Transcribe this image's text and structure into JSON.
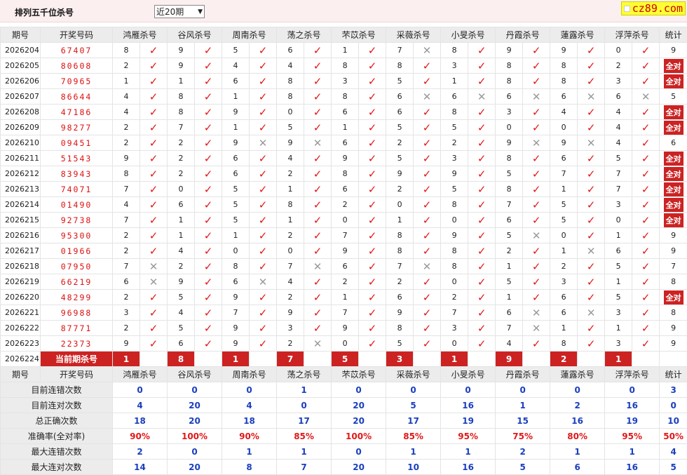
{
  "header": {
    "title": "排列五千位杀号",
    "period_select": "近20期",
    "logo": "cz89.com"
  },
  "columns": {
    "issue": "期号",
    "winning": "开奖号码",
    "experts": [
      "鸿雁杀号",
      "谷风杀号",
      "周南杀号",
      "荡之杀号",
      "芣苡杀号",
      "采薇杀号",
      "小旻杀号",
      "丹霞杀号",
      "蓮露杀号",
      "浮萍杀号"
    ],
    "stat": "统计"
  },
  "rows": [
    {
      "issue": "2026204",
      "nums": "67407",
      "kills": [
        "8",
        "9",
        "5",
        "6",
        "1",
        "7",
        "8",
        "9",
        "9",
        "0"
      ],
      "marks": [
        1,
        1,
        1,
        1,
        1,
        0,
        1,
        1,
        1,
        1
      ],
      "stat": "9"
    },
    {
      "issue": "2026205",
      "nums": "80608",
      "kills": [
        "2",
        "9",
        "4",
        "4",
        "8",
        "8",
        "3",
        "8",
        "8",
        "2"
      ],
      "marks": [
        1,
        1,
        1,
        1,
        1,
        1,
        1,
        1,
        1,
        1
      ],
      "stat": "全对"
    },
    {
      "issue": "2026206",
      "nums": "70965",
      "kills": [
        "1",
        "1",
        "6",
        "8",
        "3",
        "5",
        "1",
        "8",
        "8",
        "3"
      ],
      "marks": [
        1,
        1,
        1,
        1,
        1,
        1,
        1,
        1,
        1,
        1
      ],
      "stat": "全对"
    },
    {
      "issue": "2026207",
      "nums": "86644",
      "kills": [
        "4",
        "8",
        "1",
        "8",
        "8",
        "6",
        "6",
        "6",
        "6",
        "6"
      ],
      "marks": [
        1,
        1,
        1,
        1,
        1,
        0,
        0,
        0,
        0,
        0
      ],
      "stat": "5"
    },
    {
      "issue": "2026208",
      "nums": "47186",
      "kills": [
        "4",
        "8",
        "9",
        "0",
        "6",
        "6",
        "8",
        "3",
        "4",
        "4"
      ],
      "marks": [
        1,
        1,
        1,
        1,
        1,
        1,
        1,
        1,
        1,
        1
      ],
      "stat": "全对"
    },
    {
      "issue": "2026209",
      "nums": "98277",
      "kills": [
        "2",
        "7",
        "1",
        "5",
        "1",
        "5",
        "5",
        "0",
        "0",
        "4"
      ],
      "marks": [
        1,
        1,
        1,
        1,
        1,
        1,
        1,
        1,
        1,
        1
      ],
      "stat": "全对"
    },
    {
      "issue": "2026210",
      "nums": "09451",
      "kills": [
        "2",
        "2",
        "9",
        "9",
        "6",
        "2",
        "2",
        "9",
        "9",
        "4"
      ],
      "marks": [
        1,
        1,
        0,
        0,
        1,
        1,
        1,
        0,
        0,
        1
      ],
      "stat": "6"
    },
    {
      "issue": "2026211",
      "nums": "51543",
      "kills": [
        "9",
        "2",
        "6",
        "4",
        "9",
        "5",
        "3",
        "8",
        "6",
        "5"
      ],
      "marks": [
        1,
        1,
        1,
        1,
        1,
        1,
        1,
        1,
        1,
        1
      ],
      "stat": "全对"
    },
    {
      "issue": "2026212",
      "nums": "83943",
      "kills": [
        "8",
        "2",
        "6",
        "2",
        "8",
        "9",
        "9",
        "5",
        "7",
        "7"
      ],
      "marks": [
        1,
        1,
        1,
        1,
        1,
        1,
        1,
        1,
        1,
        1
      ],
      "stat": "全对"
    },
    {
      "issue": "2026213",
      "nums": "74071",
      "kills": [
        "7",
        "0",
        "5",
        "1",
        "6",
        "2",
        "5",
        "8",
        "1",
        "7"
      ],
      "marks": [
        1,
        1,
        1,
        1,
        1,
        1,
        1,
        1,
        1,
        1
      ],
      "stat": "全对"
    },
    {
      "issue": "2026214",
      "nums": "01490",
      "kills": [
        "4",
        "6",
        "5",
        "8",
        "2",
        "0",
        "8",
        "7",
        "5",
        "3"
      ],
      "marks": [
        1,
        1,
        1,
        1,
        1,
        1,
        1,
        1,
        1,
        1
      ],
      "stat": "全对"
    },
    {
      "issue": "2026215",
      "nums": "92738",
      "kills": [
        "7",
        "1",
        "5",
        "1",
        "0",
        "1",
        "0",
        "6",
        "5",
        "0"
      ],
      "marks": [
        1,
        1,
        1,
        1,
        1,
        1,
        1,
        1,
        1,
        1
      ],
      "stat": "全对"
    },
    {
      "issue": "2026216",
      "nums": "95300",
      "kills": [
        "2",
        "1",
        "1",
        "2",
        "7",
        "8",
        "9",
        "5",
        "0",
        "1"
      ],
      "marks": [
        1,
        1,
        1,
        1,
        1,
        1,
        1,
        0,
        1,
        1
      ],
      "stat": "9"
    },
    {
      "issue": "2026217",
      "nums": "01966",
      "kills": [
        "2",
        "4",
        "0",
        "0",
        "9",
        "8",
        "8",
        "2",
        "1",
        "6"
      ],
      "marks": [
        1,
        1,
        1,
        1,
        1,
        1,
        1,
        1,
        0,
        1
      ],
      "stat": "9"
    },
    {
      "issue": "2026218",
      "nums": "07950",
      "kills": [
        "7",
        "2",
        "8",
        "7",
        "6",
        "7",
        "8",
        "1",
        "2",
        "5"
      ],
      "marks": [
        0,
        1,
        1,
        0,
        1,
        0,
        1,
        1,
        1,
        1
      ],
      "stat": "7"
    },
    {
      "issue": "2026219",
      "nums": "66219",
      "kills": [
        "6",
        "9",
        "6",
        "4",
        "2",
        "2",
        "0",
        "5",
        "3",
        "1"
      ],
      "marks": [
        0,
        1,
        0,
        1,
        1,
        1,
        1,
        1,
        1,
        1
      ],
      "stat": "8"
    },
    {
      "issue": "2026220",
      "nums": "48299",
      "kills": [
        "2",
        "5",
        "9",
        "2",
        "1",
        "6",
        "2",
        "1",
        "6",
        "5"
      ],
      "marks": [
        1,
        1,
        1,
        1,
        1,
        1,
        1,
        1,
        1,
        1
      ],
      "stat": "全对"
    },
    {
      "issue": "2026221",
      "nums": "96988",
      "kills": [
        "3",
        "4",
        "7",
        "9",
        "7",
        "9",
        "7",
        "6",
        "6",
        "3"
      ],
      "marks": [
        1,
        1,
        1,
        1,
        1,
        1,
        1,
        0,
        0,
        1
      ],
      "stat": "8"
    },
    {
      "issue": "2026222",
      "nums": "87771",
      "kills": [
        "2",
        "5",
        "9",
        "3",
        "9",
        "8",
        "3",
        "7",
        "1",
        "1"
      ],
      "marks": [
        1,
        1,
        1,
        1,
        1,
        1,
        1,
        0,
        1,
        1
      ],
      "stat": "9"
    },
    {
      "issue": "2026223",
      "nums": "22373",
      "kills": [
        "9",
        "6",
        "9",
        "2",
        "0",
        "5",
        "0",
        "4",
        "8",
        "3"
      ],
      "marks": [
        1,
        1,
        1,
        0,
        1,
        1,
        1,
        1,
        1,
        1
      ],
      "stat": "9"
    }
  ],
  "current": {
    "issue": "2026224",
    "label": "当前期杀号",
    "kills": [
      "1",
      "8",
      "1",
      "7",
      "5",
      "3",
      "1",
      "9",
      "2",
      "1"
    ]
  },
  "summary": [
    {
      "label": "目前连错次数",
      "values": [
        "0",
        "0",
        "0",
        "1",
        "0",
        "0",
        "0",
        "0",
        "0",
        "0",
        "3"
      ]
    },
    {
      "label": "目前连对次数",
      "values": [
        "4",
        "20",
        "4",
        "0",
        "20",
        "5",
        "16",
        "1",
        "2",
        "16",
        "0"
      ]
    },
    {
      "label": "总正确次数",
      "values": [
        "18",
        "20",
        "18",
        "17",
        "20",
        "17",
        "19",
        "15",
        "16",
        "19",
        "10"
      ]
    },
    {
      "label": "准确率(全对率)",
      "values": [
        "90%",
        "100%",
        "90%",
        "85%",
        "100%",
        "85%",
        "95%",
        "75%",
        "80%",
        "95%",
        "50%"
      ]
    },
    {
      "label": "最大连错次数",
      "values": [
        "2",
        "0",
        "1",
        "1",
        "0",
        "1",
        "1",
        "2",
        "1",
        "1",
        "4"
      ]
    },
    {
      "label": "最大连对次数",
      "values": [
        "14",
        "20",
        "8",
        "7",
        "20",
        "10",
        "16",
        "5",
        "6",
        "16",
        "5"
      ]
    }
  ],
  "marks": {
    "ok": "✓",
    "bad": "✕"
  },
  "colors": {
    "accent": "#cc2222",
    "ok": "#e01818",
    "blue": "#1a3fbf",
    "header_bg": "#ececec"
  }
}
